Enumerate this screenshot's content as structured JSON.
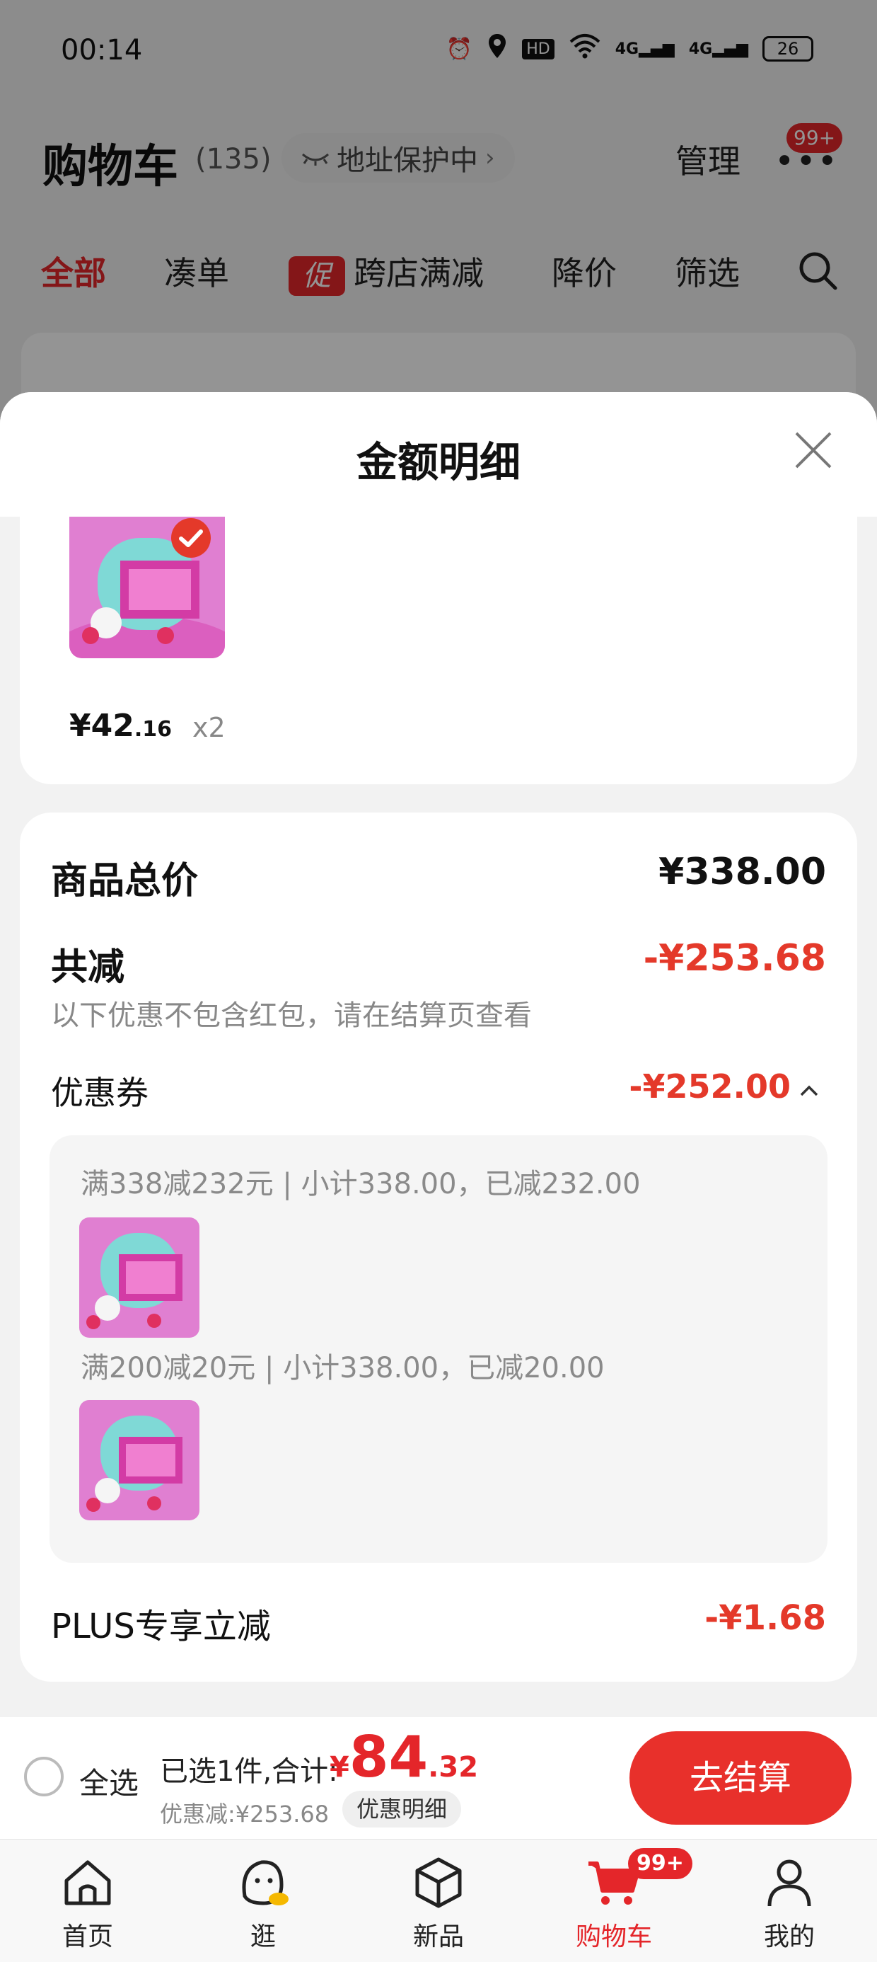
{
  "status_bar": {
    "time": "00:14",
    "network_a": "4G",
    "network_b": "4G",
    "battery": "26"
  },
  "cart_header": {
    "title": "购物车",
    "count": "(135)",
    "address_protect": "地址保护中",
    "manage": "管理",
    "more_badge": "99+"
  },
  "filter_tabs": {
    "all": "全部",
    "combine": "凑单",
    "promo_tag": "促",
    "cross_store": "跨店满减",
    "price_drop": "降价",
    "filter": "筛选"
  },
  "sheet": {
    "title": "金额明细",
    "item": {
      "price_int": "¥42",
      "price_dec": ".16",
      "qty": "x2"
    },
    "summary": {
      "goods_total_label": "商品总价",
      "goods_total_value": "¥338.00",
      "discount_label": "共减",
      "discount_value": "-¥253.68",
      "note": "以下优惠不包含红包，请在结算页查看",
      "coupon_label": "优惠券",
      "coupon_value": "-¥252.00",
      "coupon_rules": [
        "满338减232元 | 小计338.00，已减232.00",
        "满200减20元 | 小计338.00，已减20.00"
      ],
      "plus_label": "PLUS专享立减",
      "plus_value": "-¥1.68"
    }
  },
  "bottom_bar": {
    "select_all": "全选",
    "selected_text": "已选1件,合计:",
    "total_currency": "¥",
    "total_int": "84",
    "total_dec": ".32",
    "discount_text": "优惠减:¥253.68",
    "detail_button": "优惠明细",
    "checkout_button": "去结算"
  },
  "tabbar": {
    "home": "首页",
    "browse": "逛",
    "new": "新品",
    "cart": "购物车",
    "cart_badge": "99+",
    "mine": "我的"
  },
  "colors": {
    "accent_red": "#e4262a",
    "price_red": "#e4392a",
    "checkout_red": "#e8302b"
  }
}
